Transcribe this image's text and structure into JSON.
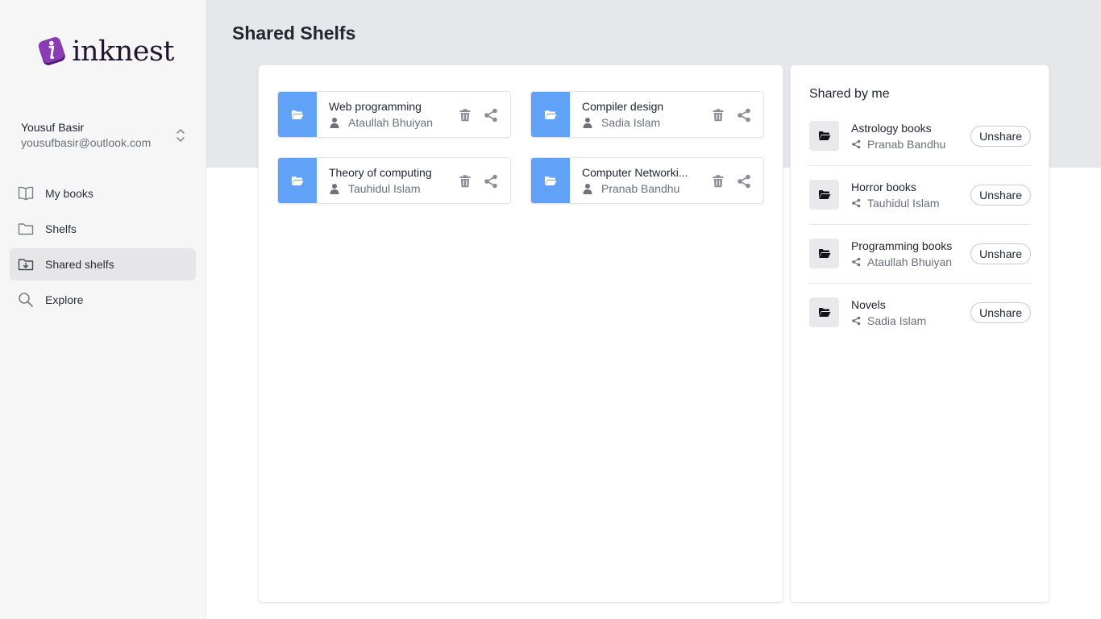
{
  "app": {
    "logo_text": "inknest"
  },
  "user": {
    "name": "Yousuf Basir",
    "email": "yousufbasir@outlook.com"
  },
  "nav": [
    {
      "label": "My books",
      "icon": "book-icon"
    },
    {
      "label": "Shelfs",
      "icon": "folder-icon"
    },
    {
      "label": "Shared shelfs",
      "icon": "folder-download-icon",
      "active": true
    },
    {
      "label": "Explore",
      "icon": "search-icon"
    }
  ],
  "page": {
    "title": "Shared Shelfs"
  },
  "shelves": [
    {
      "name": "Web programming",
      "owner": "Ataullah Bhuiyan"
    },
    {
      "name": "Compiler design",
      "owner": "Sadia Islam"
    },
    {
      "name": "Theory of computing",
      "owner": "Tauhidul Islam"
    },
    {
      "name": "Computer Networki...",
      "owner": "Pranab Bandhu"
    }
  ],
  "shared_by_me": {
    "title": "Shared by me",
    "button_label": "Unshare",
    "items": [
      {
        "name": "Astrology books",
        "shared_with": "Pranab Bandhu"
      },
      {
        "name": "Horror books",
        "shared_with": "Tauhidul Islam"
      },
      {
        "name": "Programming books",
        "shared_with": "Ataullah Bhuiyan"
      },
      {
        "name": "Novels",
        "shared_with": "Sadia Islam"
      }
    ]
  },
  "colors": {
    "accent": "#5fa2f8",
    "brand": "#7a2c9e",
    "banner": "#e6e7ea"
  }
}
